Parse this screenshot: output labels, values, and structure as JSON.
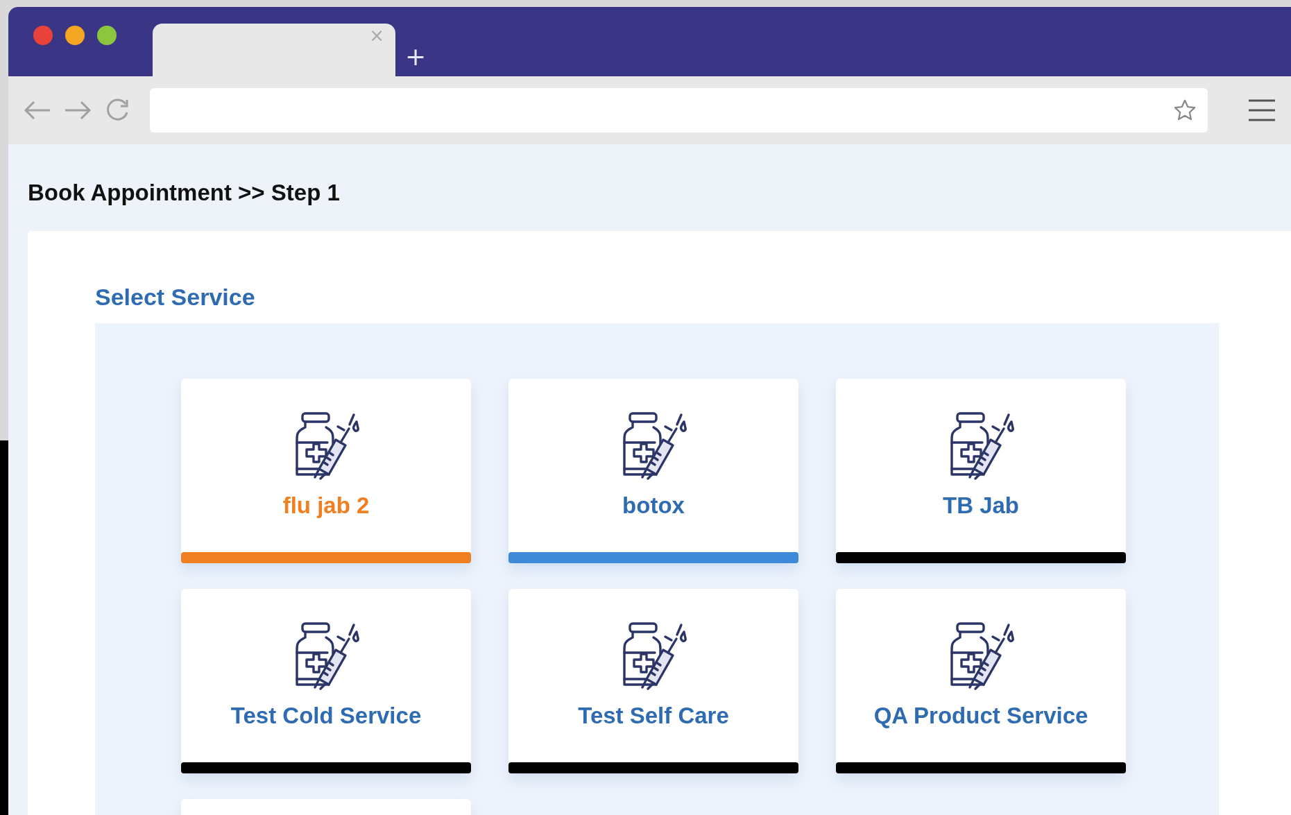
{
  "browser": {
    "tab_close": "×",
    "new_tab": "+"
  },
  "page": {
    "breadcrumb": "Book Appointment >> Step 1"
  },
  "section": {
    "title": "Select Service"
  },
  "services": [
    {
      "name": "flu jab 2",
      "selected": true,
      "color": "#f07f22"
    },
    {
      "name": "botox",
      "selected": false,
      "color": "#3f8ad8"
    },
    {
      "name": "TB Jab",
      "selected": false,
      "color": "#000000"
    },
    {
      "name": "Test Cold Service",
      "selected": false,
      "color": "#000000"
    },
    {
      "name": "Test Self Care",
      "selected": false,
      "color": "#000000"
    },
    {
      "name": "QA Product Service",
      "selected": false,
      "color": "#000000"
    }
  ],
  "more_cards_below": true
}
